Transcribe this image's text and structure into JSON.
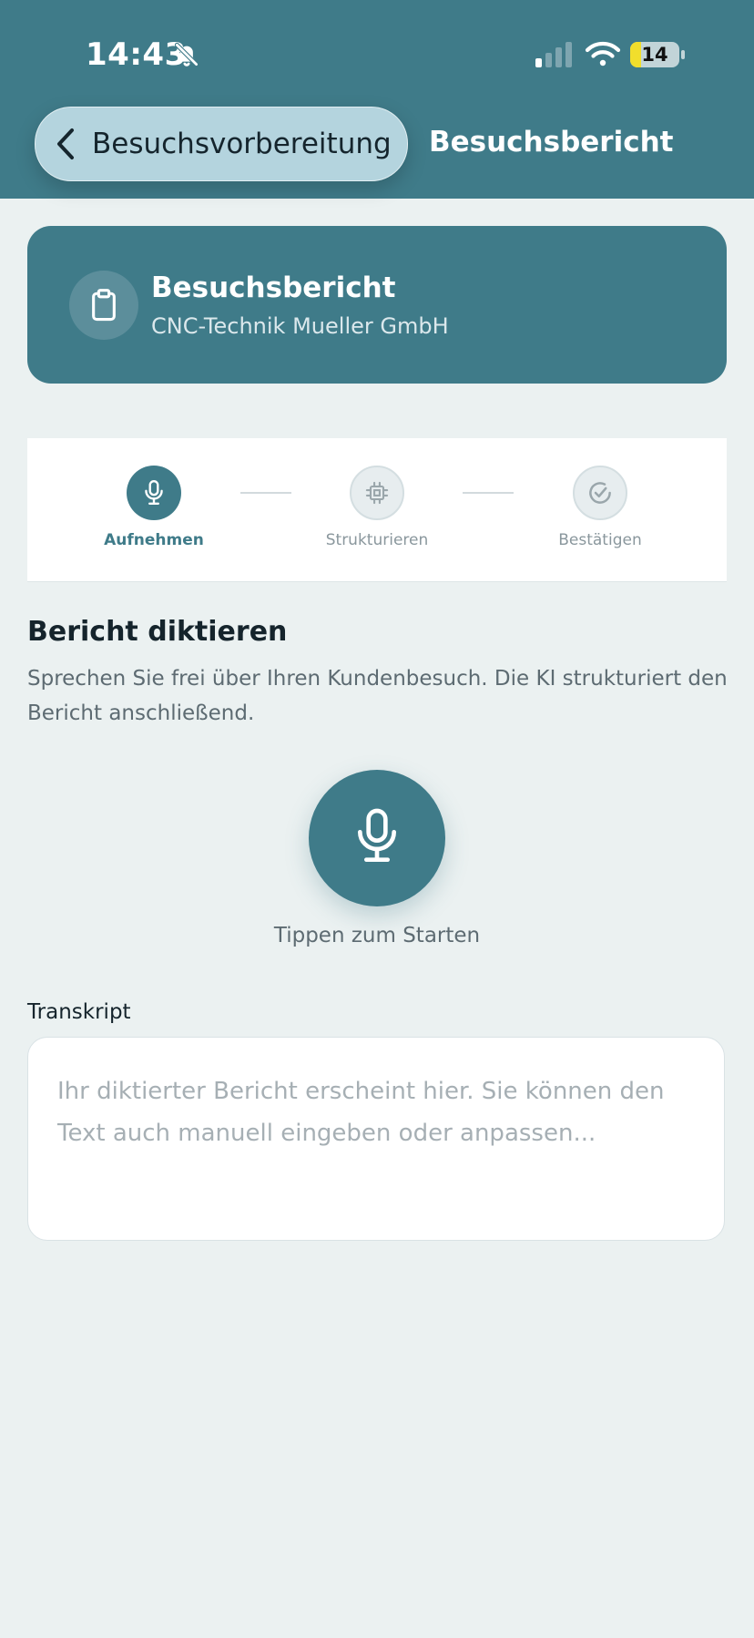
{
  "status_bar": {
    "time": "14:43",
    "battery": "14"
  },
  "nav": {
    "back_label": "Besuchsvorbereitung",
    "title": "Besuchsbericht"
  },
  "card": {
    "title": "Besuchsbericht",
    "subtitle": "CNC-Technik Mueller GmbH"
  },
  "steps": [
    {
      "label": "Aufnehmen",
      "state": "active"
    },
    {
      "label": "Strukturieren",
      "state": "inactive"
    },
    {
      "label": "Bestätigen",
      "state": "inactive"
    }
  ],
  "section": {
    "title": "Bericht diktieren",
    "description": "Sprechen Sie frei über Ihren Kundenbesuch. Die KI strukturiert den Bericht anschließend."
  },
  "record": {
    "caption": "Tippen zum Starten"
  },
  "transcript": {
    "label": "Transkript",
    "value": "",
    "placeholder": "Ihr diktierter Bericht erscheint hier. Sie können den Text auch manuell eingeben oder anpassen..."
  },
  "colors": {
    "primary": "#3f7b89",
    "background": "#ebf1f1",
    "pill": "#b4d4de"
  },
  "icons": {
    "status": [
      "bell-off-icon",
      "signal-icon",
      "wifi-icon",
      "battery-icon"
    ],
    "back": "chevron-left-icon",
    "card": "clipboard-icon",
    "steps": [
      "microphone-icon",
      "chip-icon",
      "check-circle-icon"
    ],
    "record": "microphone-icon"
  }
}
